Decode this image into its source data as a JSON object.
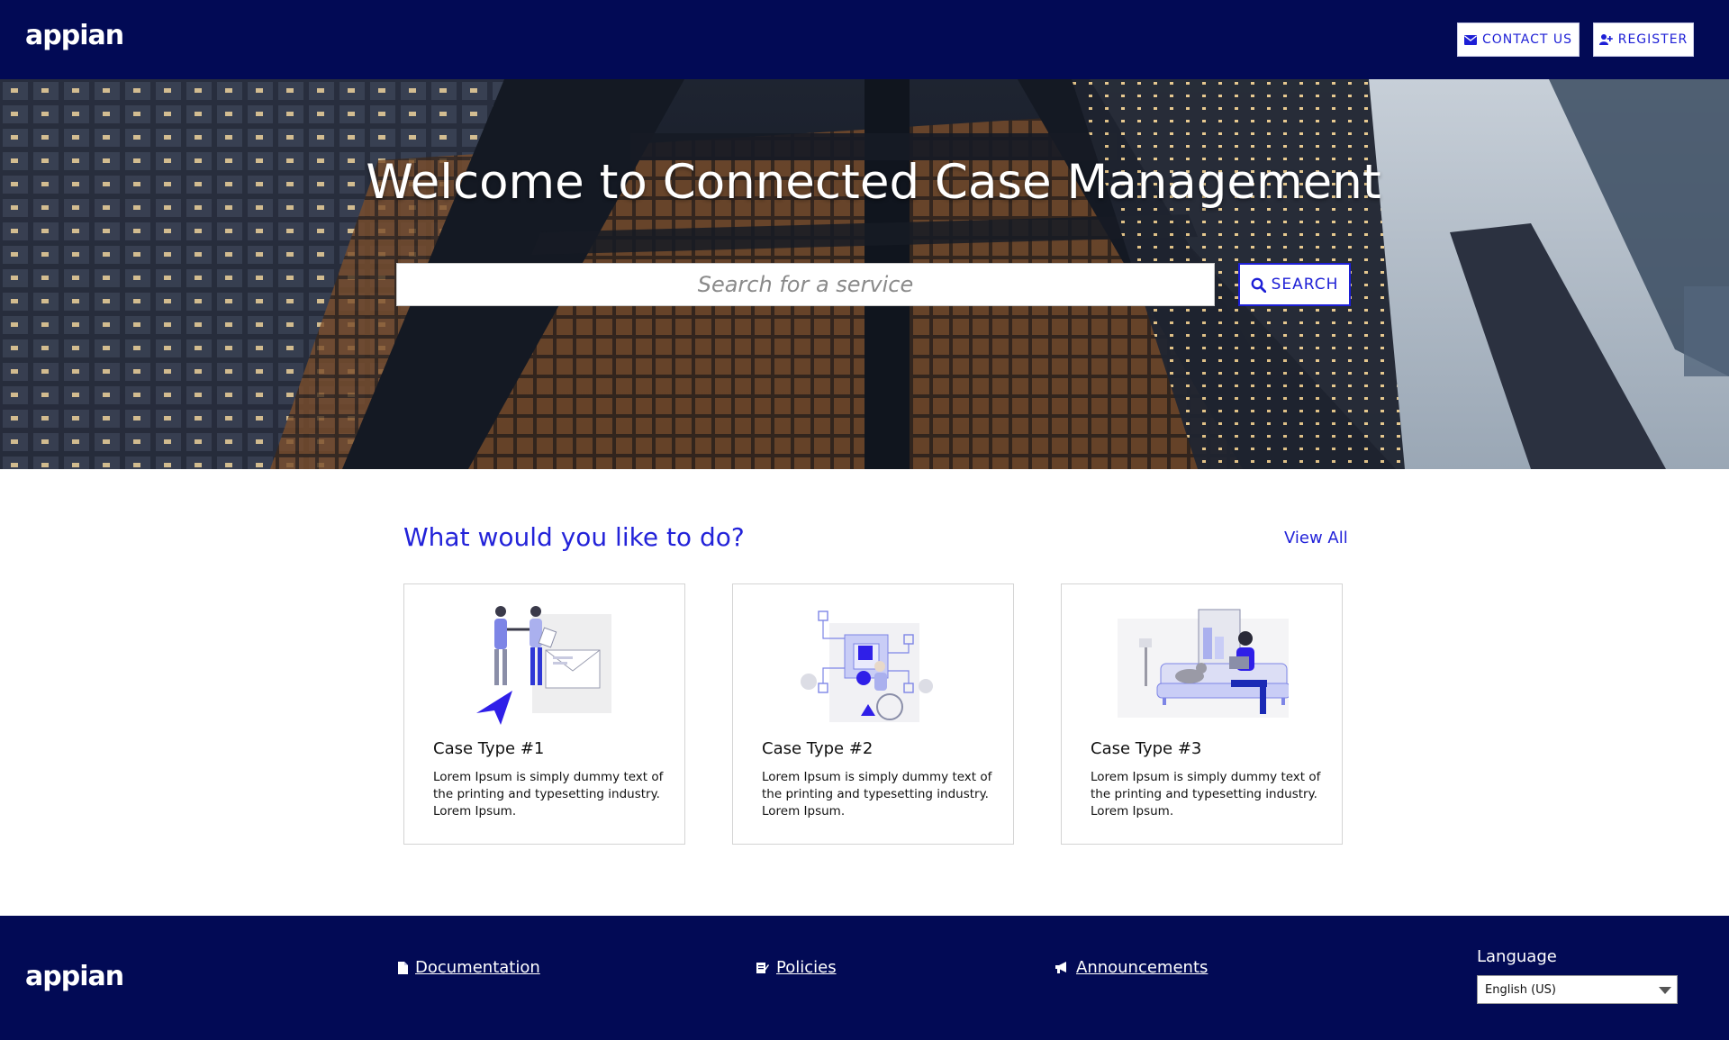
{
  "header": {
    "logo_text": "appian",
    "contact_label": "CONTACT US",
    "register_label": "REGISTER",
    "contact_icon": "envelope-icon",
    "register_icon": "user-plus-icon"
  },
  "hero": {
    "title": "Welcome to Connected Case Management",
    "search_placeholder": "Search for a service",
    "search_label": "SEARCH",
    "search_icon": "magnifier-icon"
  },
  "main": {
    "heading": "What would you like to do?",
    "view_all": "View All",
    "cards": [
      {
        "title": "Case Type #1",
        "description": "Lorem Ipsum is simply dummy text of the printing and typesetting industry. Lorem Ipsum.",
        "illustration": "handshake-illustration"
      },
      {
        "title": "Case Type #2",
        "description": "Lorem Ipsum is simply dummy text of the printing and typesetting industry. Lorem Ipsum.",
        "illustration": "workflow-illustration"
      },
      {
        "title": "Case Type #3",
        "description": "Lorem Ipsum is simply dummy text of the printing and typesetting industry. Lorem Ipsum.",
        "illustration": "remote-work-illustration"
      }
    ]
  },
  "footer": {
    "logo_text": "appian",
    "links": [
      {
        "label": "Documentation",
        "icon": "document-icon"
      },
      {
        "label": "Policies",
        "icon": "policy-icon"
      },
      {
        "label": "Announcements",
        "icon": "megaphone-icon"
      }
    ],
    "language_label": "Language",
    "language_value": "English (US)"
  },
  "colors": {
    "navy": "#020a55",
    "accent": "#2323d9"
  }
}
